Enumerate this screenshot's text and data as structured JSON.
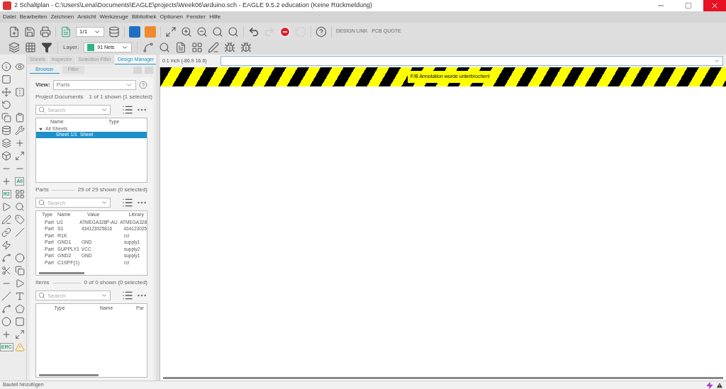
{
  "window": {
    "title": "2 Schaltplan - C:\\Users\\Lena\\Documents\\EAGLE\\projects\\Week06\\arduino.sch - EAGLE 9.5.2 education (Keine Rückmeldung)"
  },
  "menu": [
    "Datei",
    "Bearbeiten",
    "Zeichnen",
    "Ansicht",
    "Werkzeuge",
    "Bibliothek",
    "Optionen",
    "Fenster",
    "Hilfe"
  ],
  "toolbar": {
    "sheet": "1/1",
    "undo": {
      "disabled": false
    },
    "redo": {
      "disabled": true
    },
    "stop": {
      "disabled": false
    },
    "go": {
      "disabled": true
    },
    "design_link": "DESIGN LINK",
    "pcb_quote": "PCB QUOTE"
  },
  "layer_bar": {
    "label": "Layer:",
    "layer": "91 Nets"
  },
  "tool_labels": {
    "name": "R2",
    "all": "All",
    "erc": "ERC"
  },
  "panel": {
    "tabs": [
      {
        "label": "Sheets",
        "selected": false
      },
      {
        "label": "Inspector",
        "selected": false
      },
      {
        "label": "Selection Filter",
        "selected": false
      },
      {
        "label": "Design Manager",
        "selected": true
      }
    ],
    "subtabs": [
      {
        "label": "Browser",
        "selected": true
      },
      {
        "label": "Filter",
        "selected": false
      }
    ],
    "view": {
      "label": "View:",
      "value": "Parts"
    },
    "project_documents": {
      "title": "Project Documents",
      "count": "1 of 1 shown (1 selected)",
      "search_placeholder": "Search",
      "columns": [
        "Name",
        "Type"
      ],
      "tree": [
        {
          "name": "All Sheets",
          "expanded": true,
          "selected": false,
          "children": [
            {
              "name": "Sheet 1/1",
              "type": "Sheet",
              "selected": true
            }
          ]
        }
      ]
    },
    "parts": {
      "title": "Parts",
      "count": "29 of 29 shown (0 selected)",
      "search_placeholder": "Search",
      "columns": [
        "Type",
        "Name",
        "Value",
        "Library"
      ],
      "rows": [
        {
          "type": "Part",
          "name": "U1",
          "value": "ATMEGA328P-AU",
          "library": "ATMEGA328"
        },
        {
          "type": "Part",
          "name": "S1",
          "value": "434123025816",
          "library": "434123025"
        },
        {
          "type": "Part",
          "name": "R1K",
          "value": "",
          "library": "rcl"
        },
        {
          "type": "Part",
          "name": "GND1",
          "value": "GND",
          "library": "supply1"
        },
        {
          "type": "Part",
          "name": "SUPPLY1",
          "value": "VCC",
          "library": "supply2"
        },
        {
          "type": "Part",
          "name": "GND2",
          "value": "GND",
          "library": "supply1"
        },
        {
          "type": "Part",
          "name": "C1SPF(1)",
          "value": "",
          "library": "rcl"
        }
      ]
    },
    "items": {
      "title": "Items",
      "count": "0 of 0 shown (0 selected)",
      "search_placeholder": "Search",
      "columns": [
        "Type",
        "Name",
        "Par"
      ]
    }
  },
  "canvas": {
    "coordinates": "0.1 inch (-86.9 16.6)",
    "banner": "F/B Annotation wurde unterbrochen!"
  },
  "status_bar": {
    "text": "Bauteil hinzufügen"
  }
}
